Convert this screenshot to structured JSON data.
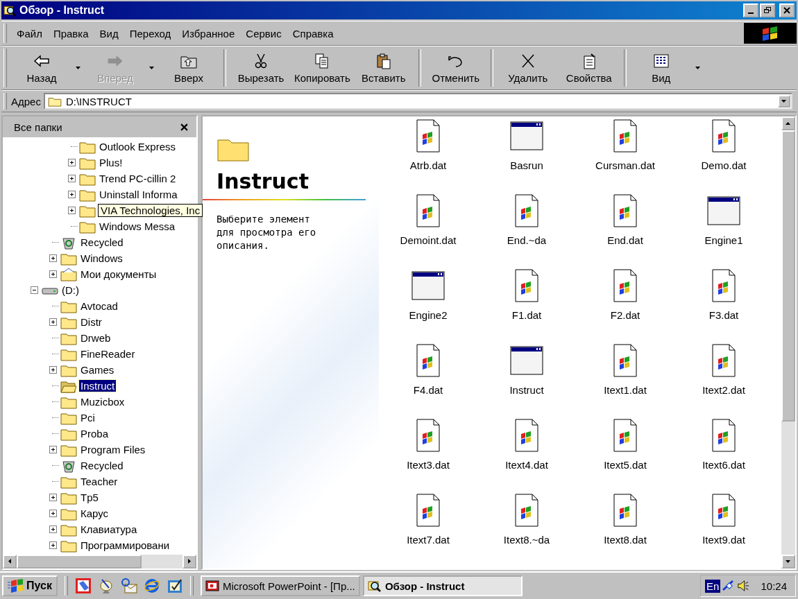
{
  "window": {
    "title": "Обзор - Instruct"
  },
  "menu": [
    "Файл",
    "Правка",
    "Вид",
    "Переход",
    "Избранное",
    "Сервис",
    "Справка"
  ],
  "toolbar": [
    [
      {
        "label": "Назад",
        "disabled": false,
        "dropdown": true
      },
      {
        "label": "Вперед",
        "disabled": true,
        "dropdown": true
      },
      {
        "label": "Вверх",
        "disabled": false,
        "dropdown": false
      }
    ],
    [
      {
        "label": "Вырезать",
        "disabled": false,
        "dropdown": false
      },
      {
        "label": "Копировать",
        "disabled": false,
        "dropdown": false
      },
      {
        "label": "Вставить",
        "disabled": false,
        "dropdown": false
      }
    ],
    [
      {
        "label": "Отменить",
        "disabled": false,
        "dropdown": false
      }
    ],
    [
      {
        "label": "Удалить",
        "disabled": false,
        "dropdown": false
      },
      {
        "label": "Свойства",
        "disabled": false,
        "dropdown": false
      }
    ],
    [
      {
        "label": "Вид",
        "disabled": false,
        "dropdown": true
      }
    ]
  ],
  "address": {
    "label": "Адрес",
    "value": "D:\\INSTRUCT"
  },
  "tree": {
    "title": "Все папки",
    "items": [
      {
        "children": [
          {
            "children": [
              {
                "label": "Outlook Express",
                "kind": "folder",
                "selected": false
              },
              {
                "label": "Plus!",
                "kind": "folder",
                "selected": false,
                "expanded": false
              },
              {
                "label": "Trend PC-cillin 2",
                "kind": "folder",
                "selected": false,
                "expanded": false
              },
              {
                "label": "Uninstall Informa",
                "kind": "folder",
                "selected": false,
                "expanded": false
              },
              {
                "tooltip": "VIA Technologies, Inc",
                "kind": "folder",
                "selected": false,
                "expanded": false
              },
              {
                "label": "Windows Messa",
                "kind": "folder",
                "selected": false
              }
            ]
          },
          {
            "label": "Recycled",
            "kind": "recycle-bin",
            "selected": false
          },
          {
            "label": "Windows",
            "kind": "folder",
            "selected": false,
            "expanded": false
          },
          {
            "label": "Мои документы",
            "kind": "documents",
            "selected": false,
            "expanded": false
          }
        ]
      },
      {
        "label": "(D:)",
        "kind": "drive",
        "selected": false,
        "expanded": true,
        "children": [
          {
            "label": "Avtocad",
            "kind": "folder",
            "selected": false
          },
          {
            "label": "Distr",
            "kind": "folder",
            "selected": false,
            "expanded": false
          },
          {
            "label": "Drweb",
            "kind": "folder",
            "selected": false
          },
          {
            "label": "FineReader",
            "kind": "folder",
            "selected": false
          },
          {
            "label": "Games",
            "kind": "folder",
            "selected": false,
            "expanded": false
          },
          {
            "label": "Instruct",
            "kind": "folder",
            "selected": true
          },
          {
            "label": "Muzicbox",
            "kind": "folder",
            "selected": false
          },
          {
            "label": "Pci",
            "kind": "folder",
            "selected": false
          },
          {
            "label": "Proba",
            "kind": "folder",
            "selected": false
          },
          {
            "label": "Program Files",
            "kind": "folder",
            "selected": false,
            "expanded": false
          },
          {
            "label": "Recycled",
            "kind": "recycle-bin",
            "selected": false
          },
          {
            "label": "Teacher",
            "kind": "folder",
            "selected": false
          },
          {
            "label": "Tp5",
            "kind": "folder",
            "selected": false,
            "expanded": false
          },
          {
            "label": "Карус",
            "kind": "folder",
            "selected": false,
            "expanded": false
          },
          {
            "label": "Клавиатура",
            "kind": "folder",
            "selected": false,
            "expanded": false
          },
          {
            "label": "Программировани",
            "kind": "folder",
            "selected": false,
            "expanded": false
          }
        ]
      }
    ]
  },
  "info": {
    "title": "Instruct",
    "description": "Выберите элемент для просмотра его описания."
  },
  "files": [
    {
      "name": "Atrb.dat",
      "kind": "document"
    },
    {
      "name": "Basrun",
      "kind": "program"
    },
    {
      "name": "Cursman.dat",
      "kind": "document"
    },
    {
      "name": "Demo.dat",
      "kind": "document"
    },
    {
      "name": "Demoint.dat",
      "kind": "document"
    },
    {
      "name": "End.~da",
      "kind": "document"
    },
    {
      "name": "End.dat",
      "kind": "document"
    },
    {
      "name": "Engine1",
      "kind": "program"
    },
    {
      "name": "Engine2",
      "kind": "program"
    },
    {
      "name": "F1.dat",
      "kind": "document"
    },
    {
      "name": "F2.dat",
      "kind": "document"
    },
    {
      "name": "F3.dat",
      "kind": "document"
    },
    {
      "name": "F4.dat",
      "kind": "document"
    },
    {
      "name": "Instruct",
      "kind": "program"
    },
    {
      "name": "Itext1.dat",
      "kind": "document"
    },
    {
      "name": "Itext2.dat",
      "kind": "document"
    },
    {
      "name": "Itext3.dat",
      "kind": "document"
    },
    {
      "name": "Itext4.dat",
      "kind": "document"
    },
    {
      "name": "Itext5.dat",
      "kind": "document"
    },
    {
      "name": "Itext6.dat",
      "kind": "document"
    },
    {
      "name": "Itext7.dat",
      "kind": "document"
    },
    {
      "name": "Itext8.~da",
      "kind": "document"
    },
    {
      "name": "Itext8.dat",
      "kind": "document"
    },
    {
      "name": "Itext9.dat",
      "kind": "document"
    }
  ],
  "taskbar": {
    "start": "Пуск",
    "tasks": [
      {
        "label": "Microsoft PowerPoint - [Пр...",
        "selected": false
      },
      {
        "label": "Обзор - Instruct",
        "selected": true
      }
    ],
    "language": "En",
    "clock": "10:24"
  }
}
